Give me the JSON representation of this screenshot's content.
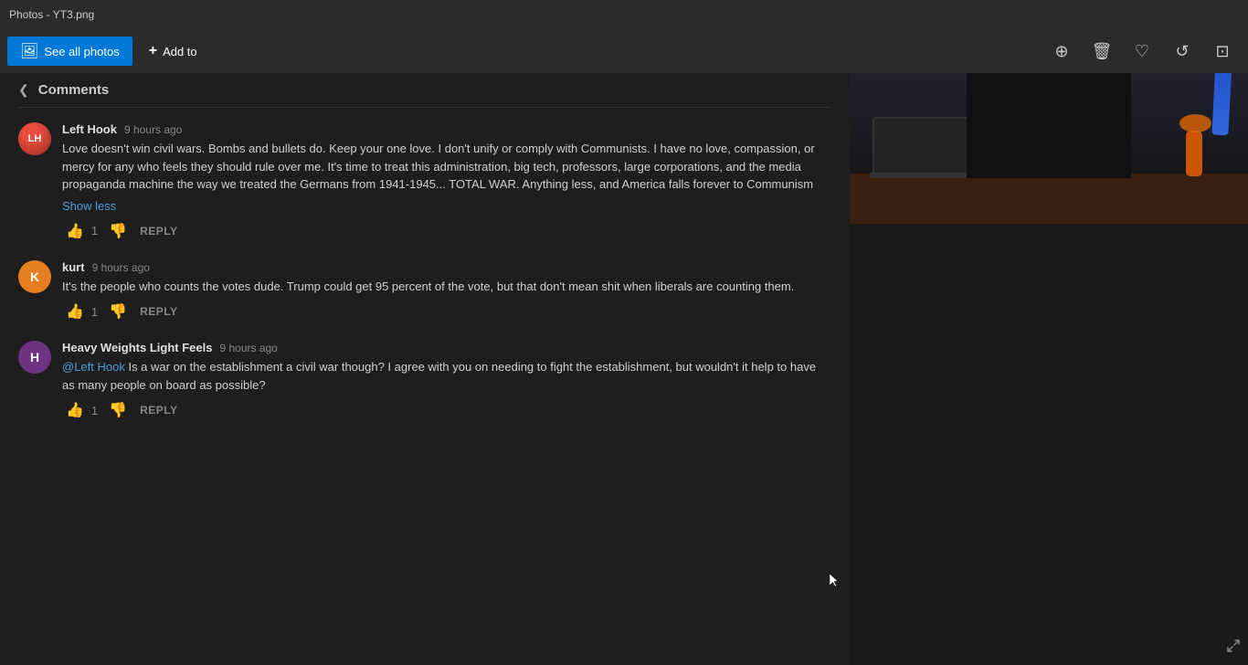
{
  "titleBar": {
    "title": "Photos - YT3.png"
  },
  "toolbar": {
    "seeAllLabel": "See all photos",
    "addToLabel": "Add to",
    "icons": {
      "zoom": "🔍",
      "trash": "🗑",
      "heart": "♡",
      "rotate": "↺",
      "crop": "⊡"
    }
  },
  "comments": {
    "title": "Comments",
    "items": [
      {
        "id": "comment-1",
        "author": "Left Hook",
        "time": "9 hours ago",
        "avatarInitial": "LH",
        "avatarColor": "#c0392b",
        "text": "Love doesn't win civil wars. Bombs and bullets do. Keep your one love. I don't unify or comply with Communists. I have no love, compassion, or mercy for any who feels they should rule over me. It's time to treat this administration, big tech, professors, large corporations, and the media propaganda machine the way we treated the Germans from 1941-1945... TOTAL WAR. Anything less, and America falls forever to Communism",
        "showLess": true,
        "likes": 1,
        "hasReply": true
      },
      {
        "id": "comment-2",
        "author": "kurt",
        "time": "9 hours ago",
        "avatarInitial": "K",
        "avatarColor": "#e67e22",
        "text": "It's the people who counts the votes dude. Trump could get 95 percent of the vote, but that don't mean shit when liberals are counting them.",
        "showLess": false,
        "likes": 1,
        "hasReply": true
      },
      {
        "id": "comment-3",
        "author": "Heavy Weights Light Feels",
        "time": "9 hours ago",
        "avatarInitial": "H",
        "avatarColor": "#6c3483",
        "mention": "@Left Hook",
        "text": " Is a war on the establishment a civil war though? I agree with you on needing to fight the establishment, but wouldn't it help to have as many people on board as possible?",
        "showLess": false,
        "likes": 1,
        "hasReply": true
      }
    ]
  },
  "buttons": {
    "showLess": "Show less",
    "reply": "REPLY"
  }
}
